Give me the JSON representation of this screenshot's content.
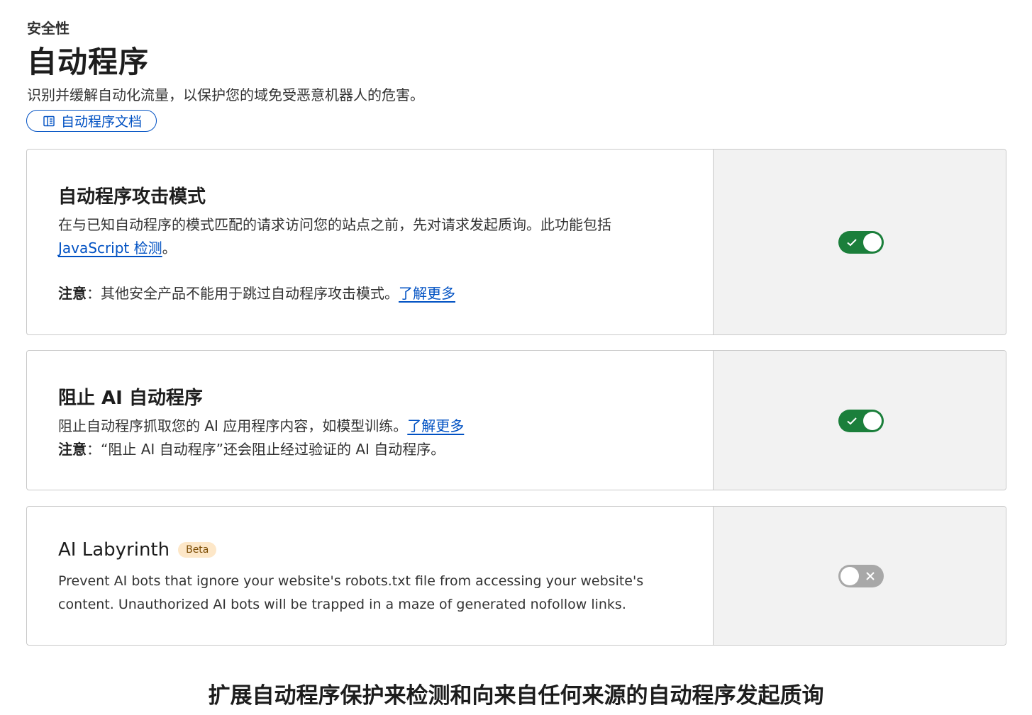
{
  "header": {
    "breadcrumb": "安全性",
    "title": "自动程序",
    "subtitle": "识别并缓解自动化流量，以保护您的域免受恶意机器人的危害。",
    "doc_button": "自动程序文档"
  },
  "cards": [
    {
      "title": "自动程序攻击模式",
      "desc_before": "在与已知自动程序的模式匹配的请求访问您的站点之前，先对请求发起质询。此功能包括",
      "desc_link": "JavaScript 检测",
      "desc_after": "。",
      "note_label": "注意",
      "note_text": "：其他安全产品不能用于跳过自动程序攻击模式。",
      "note_link": "了解更多",
      "toggle_on": true
    },
    {
      "title": "阻止 AI 自动程序",
      "desc_before": "阻止自动程序抓取您的 AI 应用程序内容，如模型训练。",
      "desc_link": "了解更多",
      "note_label": "注意",
      "note_text": "：“阻止 AI 自动程序”还会阻止经过验证的 AI 自动程序。",
      "toggle_on": true
    },
    {
      "title": "AI Labyrinth",
      "badge": "Beta",
      "desc_line1": "Prevent AI bots that ignore your website's robots.txt file from accessing your website's",
      "desc_line2": "content. Unauthorized AI bots will be trapped in a maze of generated nofollow links.",
      "toggle_on": false
    }
  ],
  "bottom_heading": "扩展自动程序保护来检测和向来自任何来源的自动程序发起质询",
  "colors": {
    "accent": "#0051c3",
    "toggle_on": "#1b7f3b",
    "toggle_off": "#a8a8a8",
    "badge_bg": "#fde7c8"
  },
  "icons": [
    "book-icon",
    "check-icon",
    "x-icon"
  ]
}
